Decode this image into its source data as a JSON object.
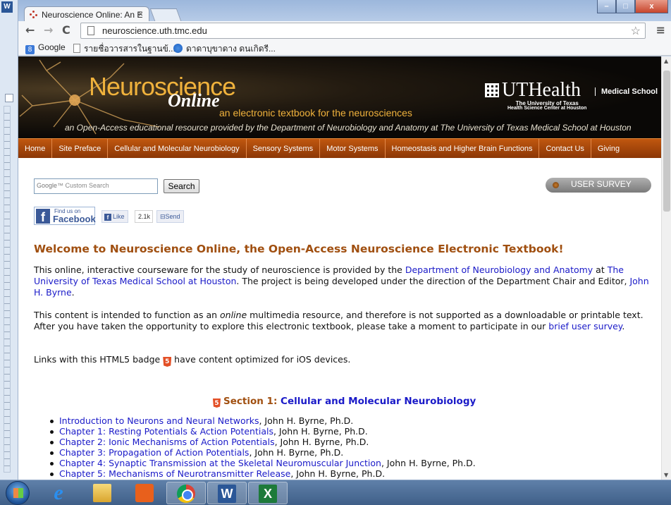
{
  "background_app": {
    "logo_letter": "W"
  },
  "browser": {
    "tab_title": "Neuroscience Online: An E",
    "tab_close": "×",
    "url": "neuroscience.uth.tmc.edu",
    "window_controls": {
      "minimize": "–",
      "maximize": "□",
      "close": "x"
    },
    "nav": {
      "back": "←",
      "forward": "→",
      "reload": "C",
      "star": "☆",
      "menu": "≡"
    },
    "bookmarks": [
      {
        "label": "Google",
        "icon": "google-icon"
      },
      {
        "label": "รายชื่อวารสารในฐานข้...",
        "icon": "page-icon"
      },
      {
        "label": "ดาดาบุขาดาง ดนเกิดรี...",
        "icon": "globe-icon"
      }
    ]
  },
  "banner": {
    "title": "Neuroscience",
    "title_script": "Online",
    "subtitle": "an electronic textbook for the neurosciences",
    "description": "an Open-Access educational resource provided by the Department of Neurobiology and Anatomy at The University of Texas Medical School at Houston",
    "uthealth": "UTHealth",
    "uth_line1": "The University of Texas",
    "uth_line2": "Health Science Center at Houston",
    "medical_school": "Medical School"
  },
  "main_nav": [
    "Home",
    "Site Preface",
    "Cellular and Molecular Neurobiology",
    "Sensory Systems",
    "Motor Systems",
    "Homeostasis and Higher Brain Functions",
    "Contact Us",
    "Giving"
  ],
  "search": {
    "placeholder_brand": "Google",
    "placeholder_text": "Custom Search",
    "button": "Search"
  },
  "survey": {
    "label": "USER SURVEY"
  },
  "facebook": {
    "find_us": "Find us on",
    "brand": "Facebook",
    "like": "Like",
    "count": "2.1k",
    "send": "Send"
  },
  "welcome": "Welcome to Neuroscience Online, the Open-Access Neuroscience Electronic Textbook!",
  "p1": {
    "a": "This online, interactive courseware for the study of neuroscience is provided by the ",
    "link1": "Department of Neurobiology and Anatomy",
    "b": " at ",
    "link2": "The University of Texas Medical School at Houston",
    "c": ". The project is being developed under the direction of the Department Chair and Editor, ",
    "link3": "John H. Byrne",
    "d": "."
  },
  "p2": {
    "a": "This content is intended to function as an ",
    "em": "online",
    "b": " multimedia resource, and therefore is not supported as a downloadable or printable text. After you have taken the opportunity to explore this electronic textbook, please take a moment to participate in our ",
    "link": "brief user survey",
    "c": "."
  },
  "p3": {
    "a": "Links with this HTML5 badge ",
    "b": " have content optimized for iOS devices."
  },
  "section": {
    "prefix": "Section 1: ",
    "title": "Cellular and Molecular Neurobiology"
  },
  "chapters": [
    {
      "title": "Introduction to Neurons and Neural Networks",
      "author": ", John H. Byrne, Ph.D."
    },
    {
      "title": "Chapter 1: Resting Potentials & Action Potentials",
      "author": ", John H. Byrne, Ph.D."
    },
    {
      "title": "Chapter 2: Ionic Mechanisms of Action Potentials",
      "author": ", John H. Byrne, Ph.D."
    },
    {
      "title": "Chapter 3: Propagation of Action Potentials",
      "author": ", John H. Byrne, Ph.D."
    },
    {
      "title": "Chapter 4: Synaptic Transmission at the Skeletal Neuromuscular Junction",
      "author": ", John H. Byrne, Ph.D."
    },
    {
      "title": "Chapter 5: Mechanisms of Neurotransmitter Release",
      "author": ", John H. Byrne, Ph.D."
    }
  ],
  "taskbar": [
    {
      "name": "ie",
      "label": "e"
    },
    {
      "name": "explorer",
      "label": ""
    },
    {
      "name": "media",
      "label": ""
    },
    {
      "name": "chrome",
      "label": ""
    },
    {
      "name": "word",
      "label": "W"
    },
    {
      "name": "excel",
      "label": "X"
    }
  ],
  "colors": {
    "nav_bg": "#a4470b",
    "heading": "#a04f10",
    "link": "#1a1ac8",
    "banner_accent": "#f0b23c"
  }
}
